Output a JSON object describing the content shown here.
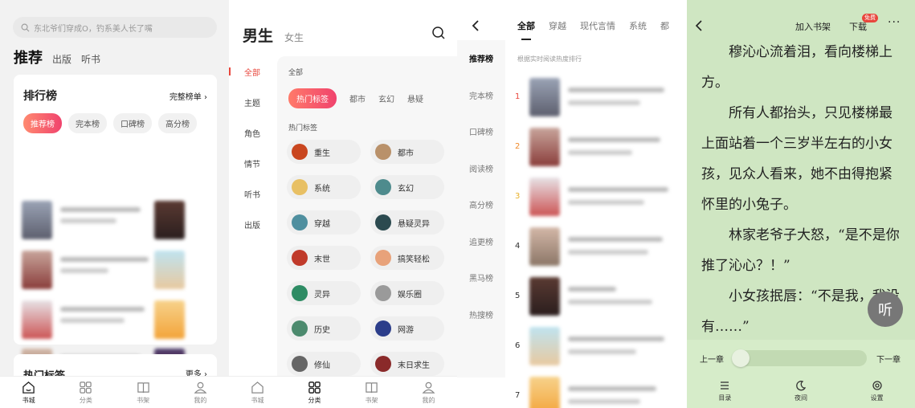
{
  "panel1": {
    "search_placeholder": "东北爷们穿成O，钓系美人长了嘴",
    "tabs": [
      "推荐",
      "出版",
      "听书"
    ],
    "ranking": {
      "title": "排行榜",
      "more": "完整榜单 ›",
      "pills": [
        "推荐榜",
        "完本榜",
        "口碑榜",
        "高分榜"
      ]
    },
    "hot_tags": {
      "title": "热门标签",
      "more": "更多 ›"
    },
    "tabbar": [
      "书城",
      "分类",
      "书架",
      "我的"
    ]
  },
  "panel2": {
    "gender_tabs": [
      "男生",
      "女生"
    ],
    "sidebar": [
      "全部",
      "主题",
      "角色",
      "情节",
      "听书",
      "出版"
    ],
    "all_label": "全部",
    "genre_tabs": [
      "热门标签",
      "都市",
      "玄幻",
      "悬疑"
    ],
    "hot_label": "热门标签",
    "tags": [
      "重生",
      "都市",
      "系统",
      "玄幻",
      "穿越",
      "悬疑灵异",
      "末世",
      "搞笑轻松",
      "灵异",
      "娱乐圈",
      "历史",
      "网游",
      "修仙",
      "末日求生"
    ],
    "tabbar": [
      "书城",
      "分类",
      "书架",
      "我的"
    ]
  },
  "panel3": {
    "tabs": [
      "全部",
      "穿越",
      "现代言情",
      "系统",
      "都"
    ],
    "sidebar": [
      "推荐榜",
      "完本榜",
      "口碑榜",
      "阅读榜",
      "高分榜",
      "追更榜",
      "黑马榜",
      "热搜榜"
    ],
    "note": "根据实时阅读热度排行",
    "ranks": [
      "1",
      "2",
      "3",
      "4",
      "5",
      "6",
      "7"
    ]
  },
  "panel4": {
    "add_shelf": "加入书架",
    "download": "下载",
    "badge": "免费",
    "more": "···",
    "paragraphs": [
      "穆沁心流着泪，看向楼梯上方。",
      "所有人都抬头，只见楼梯最上面站着一个三岁半左右的小女孩，见众人看来，她不由得抱紧怀里的小兔子。",
      "林家老爷子大怒，“是不是你推了沁心？！”",
      "小女孩抿唇：“不是我，我没有……”"
    ],
    "listen": "听",
    "prev": "上一章",
    "next": "下一章",
    "nav": [
      "目录",
      "夜间",
      "设置"
    ]
  }
}
